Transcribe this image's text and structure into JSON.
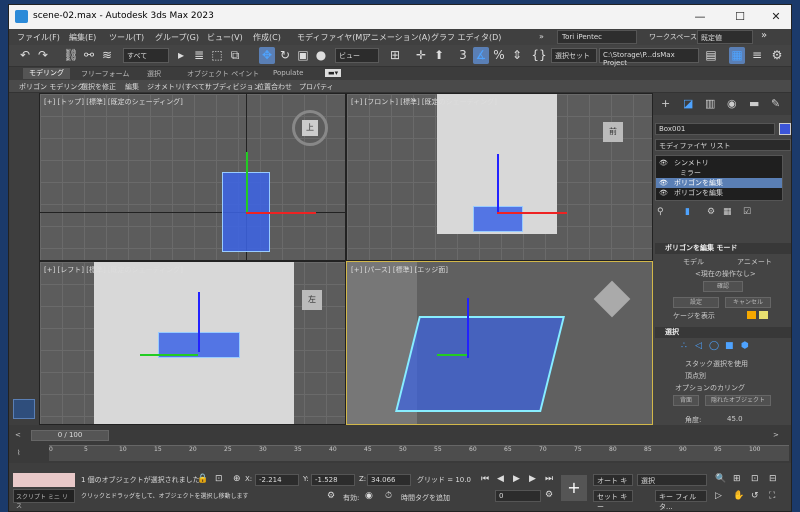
{
  "window": {
    "title": "scene-02.max - Autodesk 3ds Max 2023",
    "minimize": "—",
    "maximize": "☐",
    "close": "✕"
  },
  "menubar": {
    "items": [
      "ファイル(F)",
      "編集(E)",
      "ツール(T)",
      "グループ(G)",
      "ビュー(V)",
      "作成(C)",
      "モディファイヤ(M)",
      "アニメーション(A)",
      "グラフ エディタ(D)"
    ],
    "more": "»",
    "user": "Tori iPentec",
    "workspace_label": "ワークスペース:",
    "workspace_value": "既定値"
  },
  "toolbar": {
    "selection_filter": "すべて",
    "refcoord": "ビュー",
    "named_selection": "選択セット",
    "project_path": "C:\\Storage\\P...dsMax Project"
  },
  "ribbon": {
    "tabs": [
      "モデリング",
      "フリーフォーム",
      "選択",
      "オブジェクト ペイント",
      "Populate"
    ],
    "subtabs": [
      "ポリゴン モデリング",
      "選択を修正",
      "編集",
      "ジオメトリ(すべて)",
      "サブディビジョン",
      "位置合わせ",
      "プロパティ"
    ]
  },
  "viewports": {
    "top": {
      "label": "[+] [トップ] [標準] [既定のシェーディング]",
      "cube": "上"
    },
    "front": {
      "label": "[+] [フロント] [標準] [既定のシェーディング]",
      "cube": "前"
    },
    "left": {
      "label": "[+] [レフト] [標準] [既定のシェーディング]",
      "cube": "左"
    },
    "persp": {
      "label": "[+] [パース] [標準] [エッジ面]"
    }
  },
  "command_panel": {
    "object_name": "Box001",
    "modifier_list": "モディファイヤ リスト",
    "stack": [
      {
        "label": "シンメトリ",
        "selected": false
      },
      {
        "label": "ミラー",
        "selected": false
      },
      {
        "label": "ポリゴンを編集",
        "selected": true
      },
      {
        "label": "ポリゴンを編集",
        "selected": false
      }
    ],
    "edit_poly_mode": {
      "title": "ポリゴンを編集 モード",
      "model": "モデル",
      "animate": "アニメート",
      "current": "<現在の操作なし>",
      "confirm": "確認",
      "setting": "設定",
      "cancel": "キャンセル",
      "show_cage": "ケージを表示"
    },
    "selection": {
      "title": "選択",
      "stack_selection": "スタック選択を使用",
      "by_vertex": "頂点別",
      "options_title": "オプションのカリング",
      "back": "背面",
      "hidden": "隠れたオブジェクト",
      "angle_label": "角度:",
      "angle_value": "45.0"
    }
  },
  "timeline": {
    "frame": "0 / 100",
    "ticks": [
      "0",
      "5",
      "10",
      "15",
      "20",
      "25",
      "30",
      "35",
      "40",
      "45",
      "50",
      "55",
      "60",
      "65",
      "70",
      "75",
      "80",
      "85",
      "90",
      "95",
      "100"
    ]
  },
  "status": {
    "script": "スクリプト ミニ リス",
    "message1": "1 個のオブジェクトが選択されました",
    "message2": "クリックとドラッグをして、オブジェクトを選択し移動します",
    "x_label": "X:",
    "x": "-2.214",
    "y_label": "Y:",
    "y": "-1.528",
    "z_label": "Z:",
    "z": "34.066",
    "grid": "グリッド = 10.0",
    "enabled": "有効:",
    "add_time_tag": "時間タグを追加",
    "frame_input": "0",
    "auto_key": "オート キー",
    "set_key": "セット キー",
    "selected": "選択",
    "key_filter": "キー フィルタ..."
  }
}
